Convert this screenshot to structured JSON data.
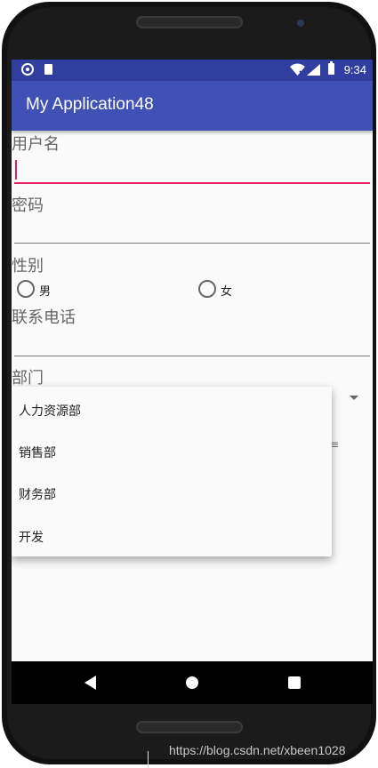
{
  "status_bar": {
    "time": "9:34",
    "icons": [
      "notification-circle-icon",
      "sd-card-icon",
      "wifi-icon",
      "signal-icon",
      "battery-icon"
    ]
  },
  "app_bar": {
    "title": "My Application48"
  },
  "form": {
    "username_label": "用户名",
    "username_value": "",
    "password_label": "密码",
    "password_value": "",
    "gender_label": "性别",
    "gender_options": [
      "男",
      "女"
    ],
    "phone_label": "联系电话",
    "phone_value": "",
    "department_label": "部门"
  },
  "department_popup": {
    "options": [
      "人力资源部",
      "销售部",
      "财务部",
      "开发"
    ]
  },
  "navigation": {
    "buttons": [
      "back-icon",
      "home-icon",
      "recents-icon"
    ]
  },
  "watermark": "https://blog.csdn.net/xbeen1028",
  "colors": {
    "status_bar": "#303f9f",
    "app_bar": "#3f51b5",
    "accent": "#e91e63",
    "background": "#fafafa"
  }
}
